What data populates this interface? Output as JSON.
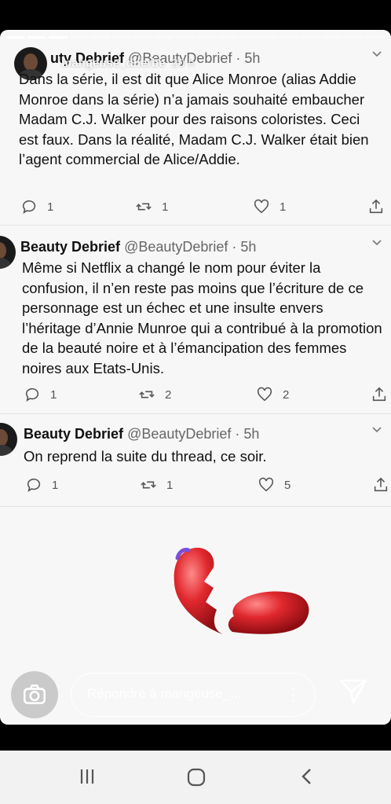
{
  "story": {
    "overlay_username": "mangeuse_dherbe",
    "overlay_time": "20 h",
    "reply_placeholder": "Répondre à mangeuse_..."
  },
  "tweets": [
    {
      "name_partial": "uty Debrief",
      "handle": "@BeautyDebrief",
      "time": "· 5h",
      "text": "Dans la série, il est dit que Alice Monroe (alias Addie Monroe dans la série) n’a jamais souhaité embaucher Madam C.J. Walker pour des raisons coloristes. Ceci est  faux. Dans la réalité, Madam C.J. Walker était bien l’agent commercial de Alice/Addie.",
      "replies": "1",
      "retweets": "1",
      "likes": "1"
    },
    {
      "name": "Beauty Debrief",
      "handle": "@BeautyDebrief",
      "time": "· 5h",
      "text": "Même si Netflix a changé le nom pour éviter la confusion, il n’en reste pas moins que l’écriture de ce personnage est un échec et une insulte envers l’héritage d’Annie Munroe qui a contribué à la promotion de la beauté noire et à l’émancipation des femmes noires aux Etats-Unis.",
      "replies": "1",
      "retweets": "2",
      "likes": "2"
    },
    {
      "name": "Beauty Debrief",
      "handle": "@BeautyDebrief",
      "time": "· 5h",
      "text": "On reprend la suite du thread, ce soir.",
      "replies": "1",
      "retweets": "1",
      "likes": "5"
    }
  ],
  "icons": {
    "reply": "comment-icon",
    "retweet": "retweet-icon",
    "like": "heart-outline-icon",
    "share": "share-icon",
    "sticker": "broken-heart-sticker",
    "camera": "camera-icon",
    "send": "send-icon"
  },
  "colors": {
    "background": "#f7f7f7",
    "text": "#111111",
    "meta": "#666666",
    "heart": "#d8262b"
  }
}
